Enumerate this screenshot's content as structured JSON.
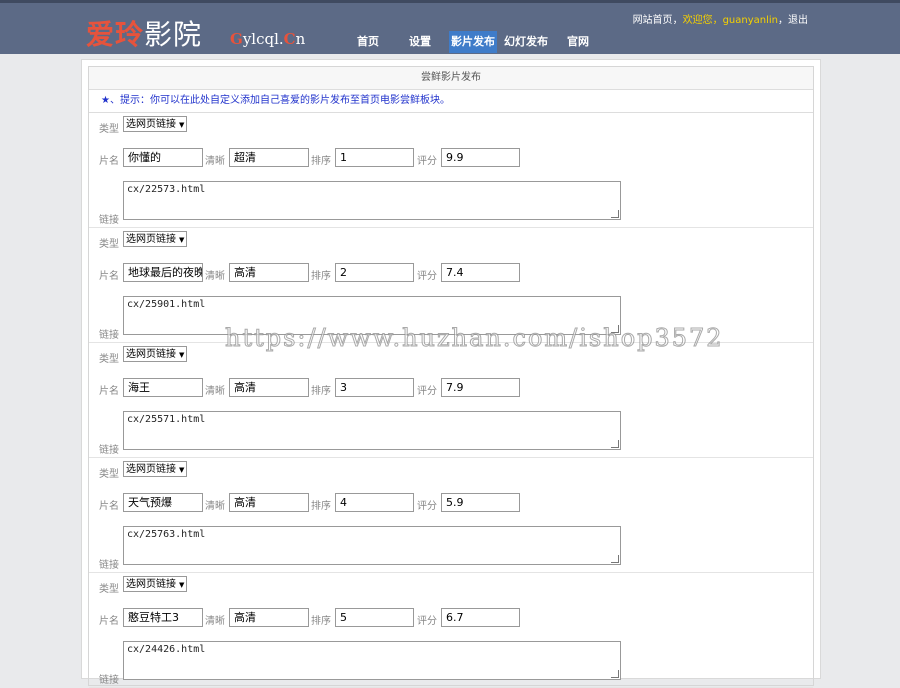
{
  "header": {
    "logo_red": "爱玲",
    "logo_white": "影院",
    "logo_sub_g": "G",
    "logo_sub_mid": "ylcql.",
    "logo_sub_c": "C",
    "logo_sub_end": "n",
    "nav": [
      {
        "label": "首页",
        "active": false
      },
      {
        "label": "设置",
        "active": false
      },
      {
        "label": "影片发布",
        "active": true
      },
      {
        "label": "幻灯发布",
        "active": false
      },
      {
        "label": "官网",
        "active": false
      }
    ],
    "user": {
      "site_home": "网站首页",
      "sep1": "，",
      "welcome": "欢迎您",
      "sep2": "，",
      "username": "guanyanlin",
      "sep3": "，",
      "logout": "退出"
    }
  },
  "panel": {
    "title": "尝鲜影片发布",
    "hint": "★、提示：你可以在此处自定义添加自己喜爱的影片发布至首页电影尝鲜板块。"
  },
  "labels": {
    "type": "类型",
    "name": "片名",
    "quality": "清晰",
    "order": "排序",
    "score": "评分",
    "link": "链接"
  },
  "entries": [
    {
      "type": "选网页链接",
      "name": "你懂的",
      "quality": "超清",
      "order": "1",
      "score": "9.9",
      "link": "cx/22573.html"
    },
    {
      "type": "选网页链接",
      "name": "地球最后的夜晚",
      "quality": "高清",
      "order": "2",
      "score": "7.4",
      "link": "cx/25901.html"
    },
    {
      "type": "选网页链接",
      "name": "海王",
      "quality": "高清",
      "order": "3",
      "score": "7.9",
      "link": "cx/25571.html"
    },
    {
      "type": "选网页链接",
      "name": "天气预爆",
      "quality": "高清",
      "order": "4",
      "score": "5.9",
      "link": "cx/25763.html"
    },
    {
      "type": "选网页链接",
      "name": "憨豆特工3",
      "quality": "高清",
      "order": "5",
      "score": "6.7",
      "link": "cx/24426.html"
    }
  ],
  "watermark": "https://www.huzhan.com/ishop3572",
  "colors": {
    "header_bg": "#5c6a86",
    "active_nav": "#3f7cc9",
    "logo_red": "#e6533c",
    "hint_blue": "#2233cc",
    "welcome_yellow": "#f5d000"
  }
}
